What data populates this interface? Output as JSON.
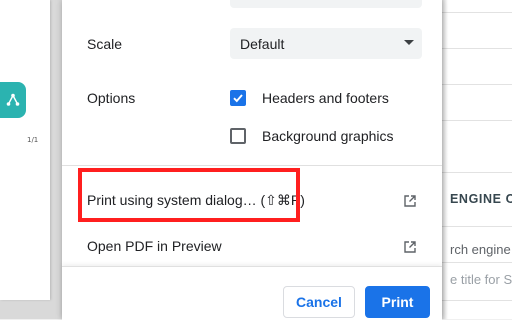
{
  "preview": {
    "page_number": "1/1"
  },
  "print_dialog": {
    "scale": {
      "label": "Scale",
      "selected": "Default"
    },
    "options": {
      "label": "Options",
      "headers_footers": {
        "label": "Headers and footers",
        "checked": true
      },
      "background_graphics": {
        "label": "Background graphics",
        "checked": false
      }
    },
    "system_dialog_link": "Print using system dialog… (⇧⌘P)",
    "open_pdf_link": "Open PDF in Preview",
    "cancel_label": "Cancel",
    "print_label": "Print"
  },
  "background_page": {
    "section_heading": "ENGINE OPTI",
    "row_text": "rch engine",
    "input_placeholder": "e title for S"
  },
  "colors": {
    "accent": "#1a73e8",
    "highlight": "#ff1f1f",
    "logo": "#2bb3b0"
  }
}
